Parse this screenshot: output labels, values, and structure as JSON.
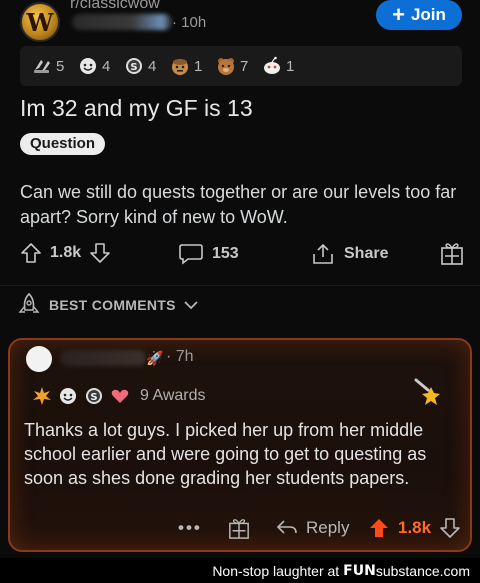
{
  "post": {
    "subreddit": "r/classicwow",
    "time": "10h",
    "join_label": "Join",
    "awards": [
      {
        "icon": "hands-award-icon",
        "count": "5"
      },
      {
        "icon": "wholesome-award-icon",
        "count": "4"
      },
      {
        "icon": "silver-award-icon",
        "count": "4"
      },
      {
        "icon": "face-award-icon",
        "count": "1"
      },
      {
        "icon": "bear-award-icon",
        "count": "7"
      },
      {
        "icon": "snoo-award-icon",
        "count": "1"
      }
    ],
    "title": "Im 32 and my GF is 13",
    "flair": "Question",
    "body": "Can we still do quests together or are our levels too far apart? Sorry kind of new to WoW.",
    "upvotes": "1.8k",
    "comments": "153",
    "share_label": "Share"
  },
  "best_comments_label": "BEST COMMENTS",
  "comment": {
    "time": "7h",
    "awards_label": "9 Awards",
    "body": "Thanks a lot guys. I picked her up from her middle school earlier and were going to get to questing as soon as shes done grading her students papers.",
    "more_label": "•••",
    "reply_label": "Reply",
    "score": "1.8k"
  },
  "footer": {
    "caption": "Non-stop laughter at",
    "brand_fun": "FUN",
    "brand_rest": "substance.com"
  },
  "colors": {
    "join_blue": "#0d6fd6",
    "upvote_orange": "#ff6a2a",
    "comment_border": "#8a3a18"
  }
}
